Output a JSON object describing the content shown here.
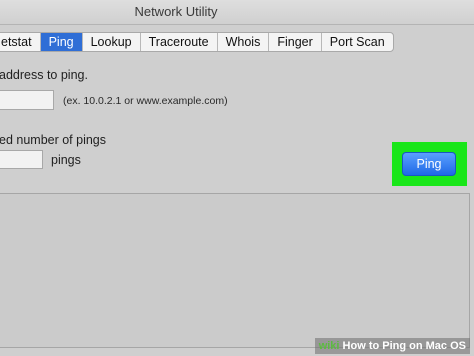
{
  "window": {
    "title": "Network Utility"
  },
  "tabs": [
    {
      "label": "etstat"
    },
    {
      "label": "Ping",
      "active": true
    },
    {
      "label": "Lookup"
    },
    {
      "label": "Traceroute"
    },
    {
      "label": "Whois"
    },
    {
      "label": "Finger"
    },
    {
      "label": "Port Scan"
    }
  ],
  "ping": {
    "address_label": "address to ping.",
    "address_value": "",
    "address_hint": "(ex. 10.0.2.1 or www.example.com)",
    "count_label": "ed number of pings",
    "count_value": "",
    "count_unit": "pings",
    "button_label": "Ping",
    "highlight_color": "#19e619"
  },
  "watermark": {
    "brand": "wiki",
    "text": "How to Ping on Mac OS"
  }
}
